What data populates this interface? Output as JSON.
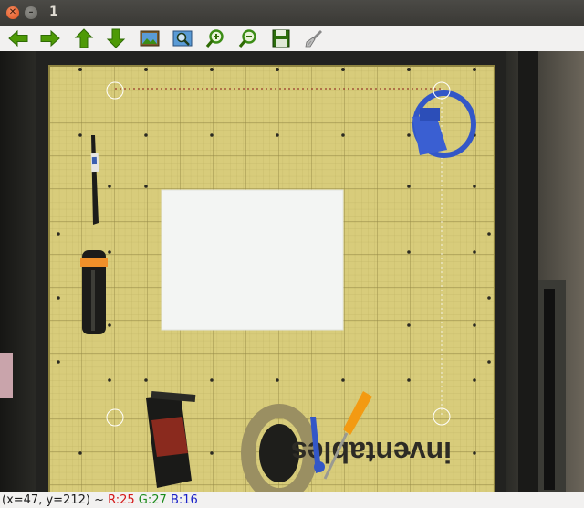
{
  "window": {
    "title": "1"
  },
  "titlebar": {
    "close_icon": "close-icon",
    "minimize_icon": "minimize-icon",
    "close_glyph": "✕",
    "minimize_glyph": "–"
  },
  "toolbar": {
    "items": [
      {
        "name": "pan-left-button",
        "icon": "arrow-left-icon"
      },
      {
        "name": "pan-right-button",
        "icon": "arrow-right-icon"
      },
      {
        "name": "pan-up-button",
        "icon": "arrow-up-icon"
      },
      {
        "name": "pan-down-button",
        "icon": "arrow-down-icon"
      },
      {
        "name": "zoom-original-button",
        "icon": "picture-icon"
      },
      {
        "name": "zoom-fit-button",
        "icon": "zoom-fit-icon"
      },
      {
        "name": "zoom-in-button",
        "icon": "zoom-in-icon"
      },
      {
        "name": "zoom-out-button",
        "icon": "zoom-out-icon"
      },
      {
        "name": "save-button",
        "icon": "floppy-disk-icon"
      },
      {
        "name": "properties-button",
        "icon": "brush-icon"
      }
    ],
    "colors": {
      "arrow": "#4e9a06",
      "arrow_dark": "#2f6b04",
      "zoom_green": "#3c8d16",
      "save": "#2c6f0c"
    }
  },
  "image": {
    "logo_text": "inventables",
    "colors": {
      "board": "#d9cd7c",
      "grid": "#a99d4e",
      "paper": "#f4f6f4",
      "marker_circle": "#ffffff",
      "clamp": "#3357c7",
      "screwdriver": "#f39a12"
    }
  },
  "status": {
    "coords": "(x=47, y=212) ~ ",
    "r": "R:25",
    "g": "G:27",
    "b": "B:16"
  }
}
